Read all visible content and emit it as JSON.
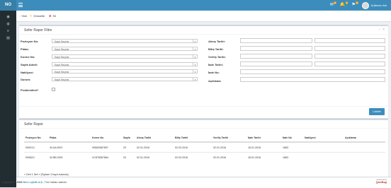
{
  "app": {
    "logo": "NO"
  },
  "top_icons": [
    {
      "icon": "mail-icon",
      "glyph": "✉",
      "badge": "0"
    },
    {
      "icon": "bell-icon",
      "glyph": "🔔",
      "badge": "0"
    },
    {
      "icon": "flag-icon",
      "glyph": "⚑",
      "badge": "0"
    }
  ],
  "user": {
    "name": "Kullanıcı Adı"
  },
  "sidebar": {
    "items": [
      {
        "icon": "dashboard-icon",
        "glyph": "◉"
      },
      {
        "icon": "globe-icon",
        "glyph": "◍"
      },
      {
        "icon": "list-icon",
        "glyph": "≡"
      },
      {
        "icon": "book-icon",
        "glyph": "▤"
      }
    ]
  },
  "toolbar": {
    "new_label": "Yeni",
    "update_label": "Güncelle",
    "delete_label": "Sil"
  },
  "filter": {
    "title": "Sefer Rapor Filtre",
    "select_placeholder": "Kayıt Seçiniz",
    "left_fields": [
      "Pozisyon No:",
      "Plaka:",
      "Korme No:",
      "Sayfa Adedi:",
      "Nakliyeci:",
      "Durum:"
    ],
    "problem_label": "Problemlimi?",
    "right_fields": [
      "Alınış Tarihi:",
      "Bitiş Tarihi:",
      "Veriliş Tarihi:",
      "İade Tarihi:",
      "İade No:",
      "Açıklama"
    ],
    "listele_label": "Listele"
  },
  "report": {
    "title": "Sefer Rapor",
    "columns": [
      "Pozisyon No",
      "Plaka",
      "Korne No",
      "Sayfa",
      "Alınış Tarihi",
      "Bitiş Tarihi",
      "Veriliş Tarihi",
      "İade Tarihi",
      "İade No",
      "Nakliyeci",
      "Açıklama"
    ],
    "rows": [
      [
        "00001/1",
        "34 AA 0001",
        "XB653567897",
        "20",
        "02.01.2016",
        "02.03.2016",
        "02.01.2016",
        "18.01.2016",
        "1683",
        "",
        ""
      ],
      [
        "00082/1",
        "34 BB 0001",
        "XC876567864",
        "20",
        "02.01.2016",
        "02.03.2016",
        "02.01.2016",
        "18.01.2016",
        "1683",
        "",
        ""
      ]
    ],
    "pager": "« Geri 1 İleri » [Toplam 3 kayıt bulundu]"
  },
  "footer": {
    "copyright_prefix": "Copyright © 2016",
    "company": "Neo Lojistik A.Ş.",
    "rights": "Tüm hakları saklıdır.",
    "powered_by": "powered by",
    "powered_brand": "QueBag"
  },
  "colors": {
    "header": "#3c8dbc",
    "logo_bg": "#367fa9",
    "sidebar": "#222d32",
    "button": "#3c8dbc",
    "delete": "#dd4b39"
  }
}
